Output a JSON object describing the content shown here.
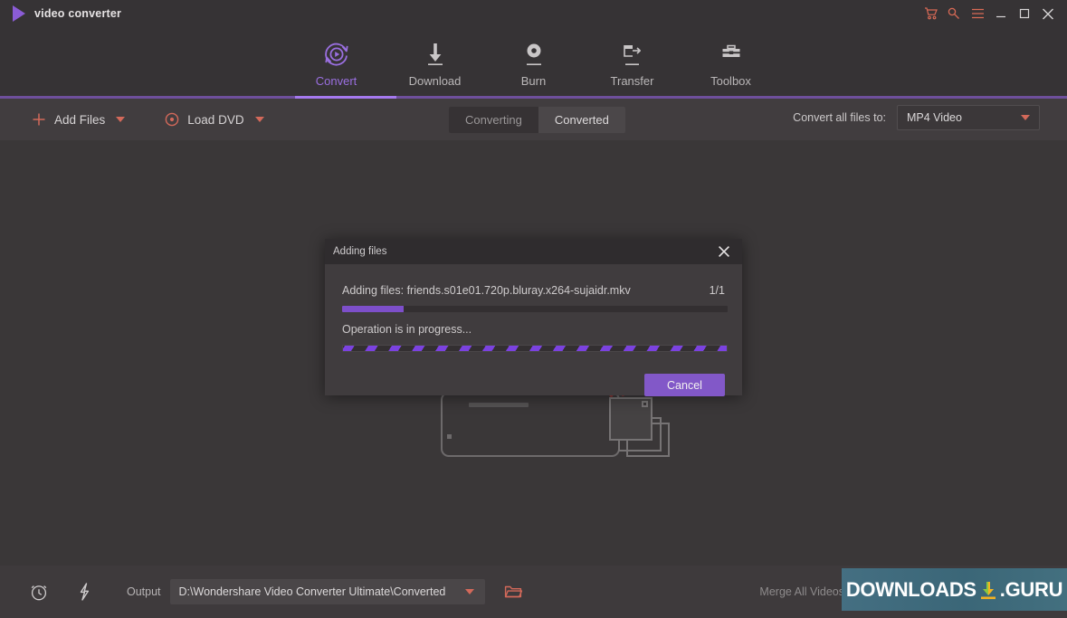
{
  "app": {
    "brand": "video converter",
    "logo_icon": "play-triangle-icon",
    "accent_purple": "#8b5cd6",
    "accent_orange": "#d3695a",
    "background": "#3a3738"
  },
  "window_controls": [
    {
      "name": "cart-icon",
      "label": "Cart",
      "color": "#d96a56"
    },
    {
      "name": "key-icon",
      "label": "Register",
      "color": "#d96a56"
    },
    {
      "name": "menu-icon",
      "label": "Menu",
      "color": "#d96a56"
    },
    {
      "name": "minimize-icon",
      "label": "Minimize",
      "color": "#d8d5d6"
    },
    {
      "name": "maximize-icon",
      "label": "Maximize",
      "color": "#d8d5d6"
    },
    {
      "name": "close-icon",
      "label": "Close",
      "color": "#d8d5d6"
    }
  ],
  "nav": {
    "items": [
      {
        "label": "Convert",
        "icon": "convert-circle-play-icon",
        "active": true
      },
      {
        "label": "Download",
        "icon": "download-arrow-icon",
        "active": false
      },
      {
        "label": "Burn",
        "icon": "burn-disc-icon",
        "active": false
      },
      {
        "label": "Transfer",
        "icon": "transfer-arrow-icon",
        "active": false
      },
      {
        "label": "Toolbox",
        "icon": "toolbox-icon",
        "active": false
      }
    ]
  },
  "toolbar": {
    "add_files_label": "Add Files",
    "add_files_icon": "plus-icon",
    "load_dvd_label": "Load DVD",
    "load_dvd_icon": "disc-icon",
    "tabs": [
      {
        "label": "Converting",
        "active": true
      },
      {
        "label": "Converted",
        "active": false
      }
    ],
    "convert_all_label": "Convert all files to:",
    "format_value": "MP4 Video"
  },
  "content": {
    "dropzone_illustration": "drag-drop-files-illustration"
  },
  "dialog": {
    "title": "Adding files",
    "close_icon": "close-icon",
    "adding_text": "Adding files: friends.s01e01.720p.bluray.x264-sujaidr.mkv",
    "count": "1/1",
    "progress_percent": 16,
    "operation_text": "Operation is in progress...",
    "cancel_label": "Cancel",
    "progress_color": "#7d4fca",
    "button_color": "#8258c8"
  },
  "bottom_bar": {
    "timer_icon": "alarm-clock-icon",
    "bolt_icon": "lightning-bolt-icon",
    "output_label": "Output",
    "output_path": "D:\\Wondershare Video Converter Ultimate\\Converted",
    "folder_icon": "open-folder-icon",
    "merge_label": "Merge All Videos"
  },
  "watermark": {
    "text_left": "DOWNLOADS",
    "text_right": ".GURU",
    "icon": "download-arrow-icon",
    "background": "#3f6e80"
  }
}
